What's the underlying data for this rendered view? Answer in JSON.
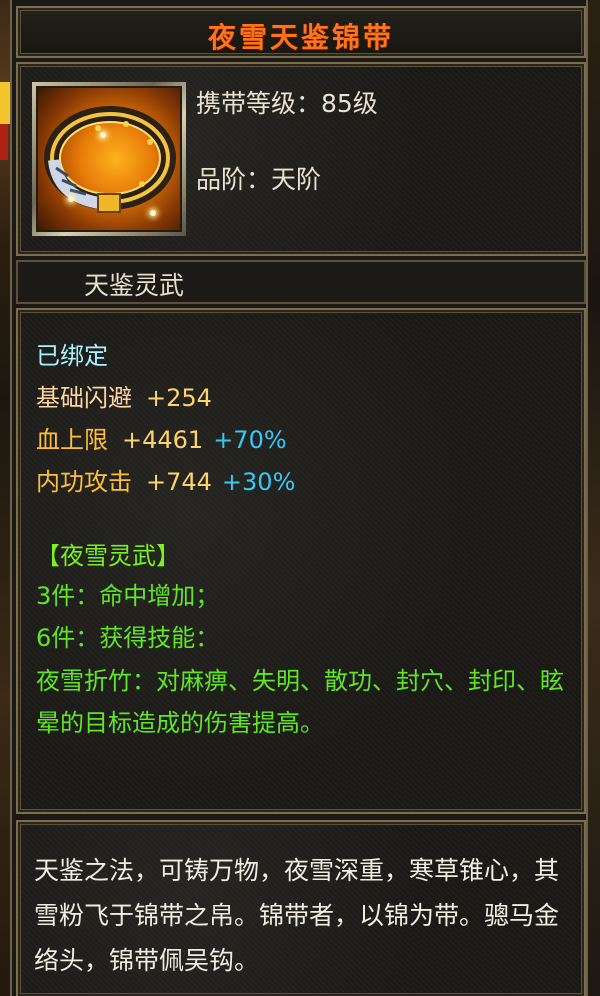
{
  "tooltip": {
    "item_name": "夜雪天鉴锦带",
    "carry_level": "携带等级：85级",
    "grade": "品阶：天阶",
    "set_series": "天鉴灵武",
    "bound_status": "已绑定",
    "attributes": [
      {
        "name": "基础闪避",
        "base": "+254",
        "bonus": ""
      },
      {
        "name": "血上限",
        "base": "+4461",
        "bonus": "+70%"
      },
      {
        "name": "内功攻击",
        "base": "+744",
        "bonus": "+30%"
      }
    ],
    "set_bonus": {
      "title": "【夜雪灵武】",
      "piece3": "3件：命中增加；",
      "piece6": "6件：获得技能：",
      "skill": "夜雪折竹：对麻痹、失明、散功、封穴、封印、眩晕的目标造成的伤害提高。"
    },
    "description": "天鉴之法，可铸万物，夜雪深重，寒草锥心，其雪粉飞于锦带之帛。锦带者，以锦为带。骢马金络头，锦带佩吴钩。"
  },
  "colors": {
    "title": "#ff7417",
    "bound": "#a9f3ff",
    "base_value": "#ffd36c",
    "bonus_value": "#38c8f5",
    "set_text": "#5fe625"
  },
  "icons": {
    "item": "golden-belt-icon"
  }
}
